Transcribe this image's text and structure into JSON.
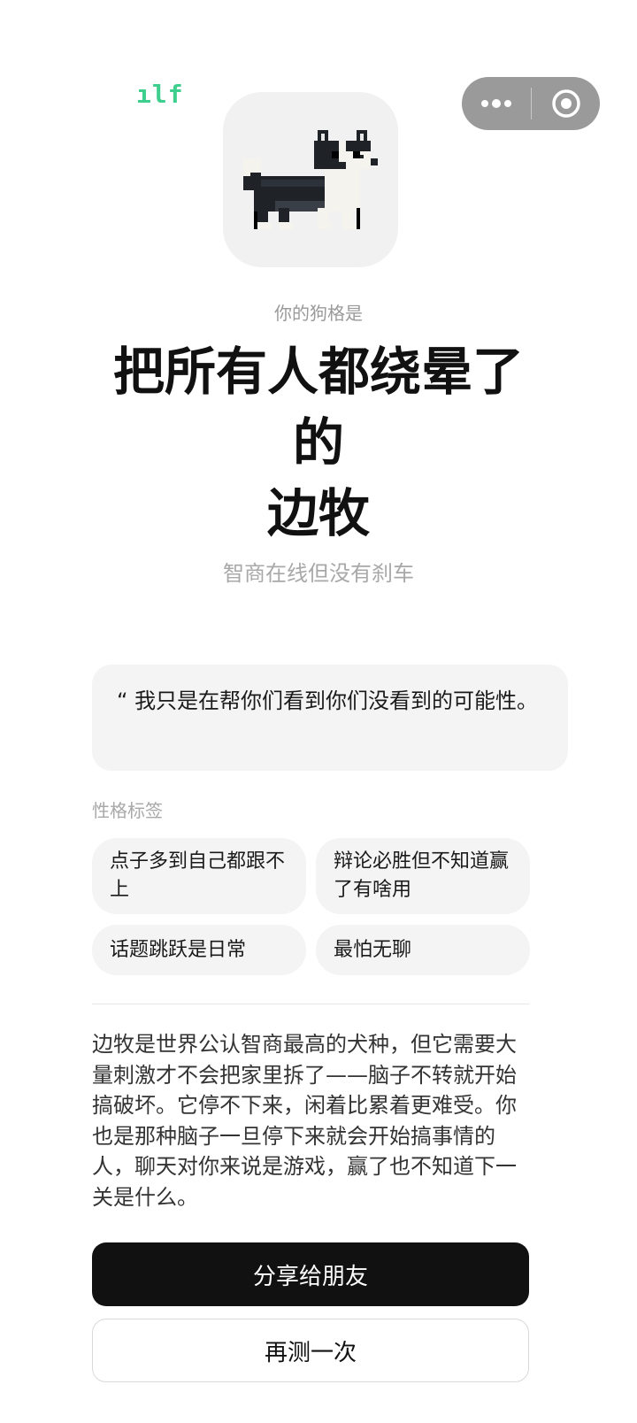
{
  "brand_fragment": "ılf",
  "capsule": {
    "more_icon": "more-dots-icon",
    "close_icon": "target-circle-icon"
  },
  "avatar": {
    "icon": "pixel-border-collie-icon"
  },
  "result": {
    "label": "你的狗格是",
    "title_line1": "把所有人都绕晕了",
    "title_line2": "的",
    "title_line3": "边牧",
    "tagline": "智商在线但没有刹车"
  },
  "quote": "“ 我只是在帮你们看到你们没看到的可能性。",
  "tags": {
    "heading": "性格标签",
    "items": [
      "点子多到自己都跟不上",
      "辩论必胜但不知道赢了有啥用",
      "话题跳跃是日常",
      "最怕无聊"
    ]
  },
  "description": "边牧是世界公认智商最高的犬种，但它需要大量刺激才不会把家里拆了——脑子不转就开始搞破坏。它停不下来，闲着比累着更难受。你也是那种脑子一旦停下来就会开始搞事情的人，聊天对你来说是游戏，赢了也不知道下一关是什么。",
  "actions": {
    "share_label": "分享给朋友",
    "retry_label": "再测一次"
  },
  "colors": {
    "brand_green": "#3ecf8e",
    "capsule_gray": "#9a9a9a",
    "card_bg": "#f4f4f4",
    "primary_button": "#111111"
  }
}
